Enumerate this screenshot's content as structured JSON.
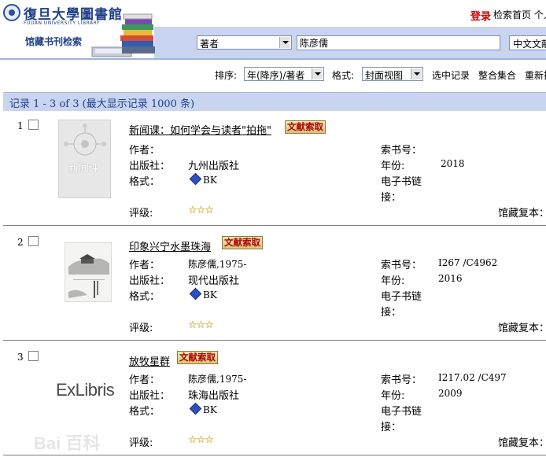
{
  "header": {
    "logo_cn": "復旦大學圖書館",
    "logo_en": "FUDAN UNIVERSITY LIBRARY",
    "site_title": "馆藏书刊检索",
    "login_label": "登录",
    "home_label": "检索首页 个人",
    "search": {
      "field": "著者",
      "query": "陈彦儒",
      "database": "中文文献"
    }
  },
  "toolbar": {
    "sort_label": "排序:",
    "sort_value": "年(降序)/著者",
    "format_label": "格式:",
    "format_value": "封面视图",
    "select_records": "选中记录",
    "merge_sets": "整合集合",
    "re_sort": "重新排序"
  },
  "results": {
    "summary": "记录 1 - 3 of 3 (最大显示记录 1000 条)"
  },
  "labels": {
    "author": "作者：",
    "publisher": "出版社：",
    "format": "格式：",
    "rating": "评级:",
    "call_number": "索书号：",
    "year": "年份:",
    "ebook_link_1": "电子书链",
    "ebook_link_2": "接：",
    "holdings": "馆藏复本：",
    "doc_button": "文献索取",
    "format_value": "BK",
    "stars": "☆☆☆"
  },
  "records": [
    {
      "num": "1",
      "title": "新闻课：如何学会与读者\"拍拖\"",
      "author": "",
      "publisher": "九州出版社",
      "call_number": "",
      "year": "2018",
      "cover_title": "新闻课"
    },
    {
      "num": "2",
      "title": "印象兴宁水墨珠海",
      "author": "陈彦儒,1975-",
      "publisher": "现代出版社",
      "call_number": "I267 /C4962",
      "year": "2016"
    },
    {
      "num": "3",
      "title": "放牧星群",
      "author": "陈彦儒,1975-",
      "publisher": "珠海出版社",
      "call_number": "I217.02 /C497",
      "year": "2009",
      "cover_placeholder": "ExLibris"
    }
  ],
  "watermark": "Bai 百科"
}
